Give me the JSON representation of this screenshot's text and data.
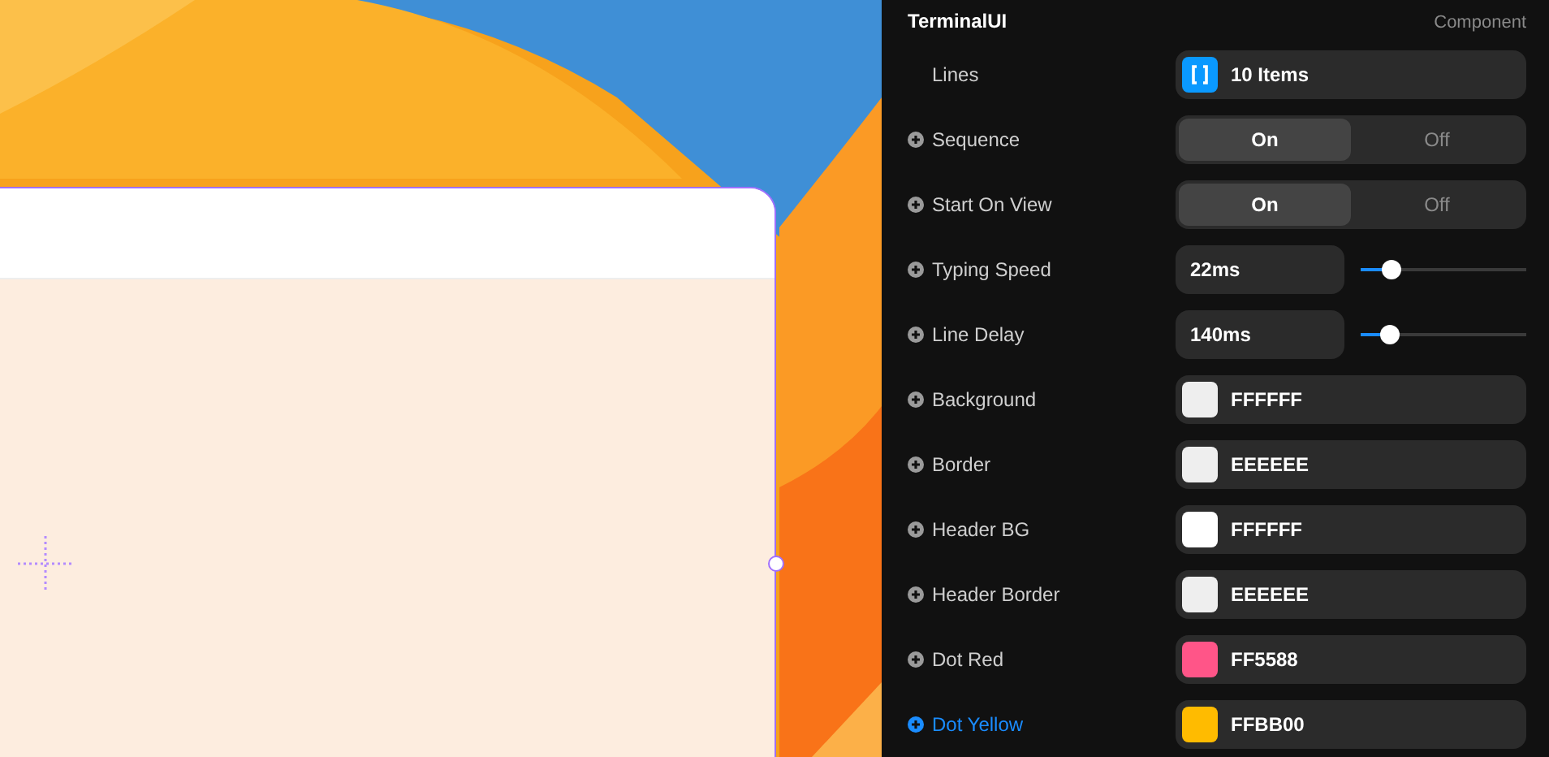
{
  "panel": {
    "title": "TerminalUI",
    "subtitle": "Component",
    "rows": [
      {
        "kind": "array",
        "label": "Lines",
        "selected": false,
        "value": "10 Items"
      },
      {
        "kind": "segmented",
        "label": "Sequence",
        "selected": false,
        "options": [
          {
            "label": "On",
            "selected": true
          },
          {
            "label": "Off",
            "selected": false
          }
        ]
      },
      {
        "kind": "segmented",
        "label": "Start On View",
        "selected": false,
        "options": [
          {
            "label": "On",
            "selected": true
          },
          {
            "label": "Off",
            "selected": false
          }
        ]
      },
      {
        "kind": "slider",
        "label": "Typing Speed",
        "selected": false,
        "value": "22ms",
        "level": 0.19
      },
      {
        "kind": "slider",
        "label": "Line Delay",
        "selected": false,
        "value": "140ms",
        "level": 0.18
      },
      {
        "kind": "color",
        "label": "Background",
        "selected": false,
        "value": "FFFFFF",
        "color": "#eeeeee"
      },
      {
        "kind": "color",
        "label": "Border",
        "selected": false,
        "value": "EEEEEE",
        "color": "#eeeeee"
      },
      {
        "kind": "color",
        "label": "Header BG",
        "selected": false,
        "value": "FFFFFF",
        "color": "#ffffff"
      },
      {
        "kind": "color",
        "label": "Header Border",
        "selected": false,
        "value": "EEEEEE",
        "color": "#eeeeee"
      },
      {
        "kind": "color",
        "label": "Dot Red",
        "selected": false,
        "value": "FF5588",
        "color": "#ff5588"
      },
      {
        "kind": "color",
        "label": "Dot Yellow",
        "selected": true,
        "value": "FFBB00",
        "color": "#ffbb00"
      }
    ]
  }
}
